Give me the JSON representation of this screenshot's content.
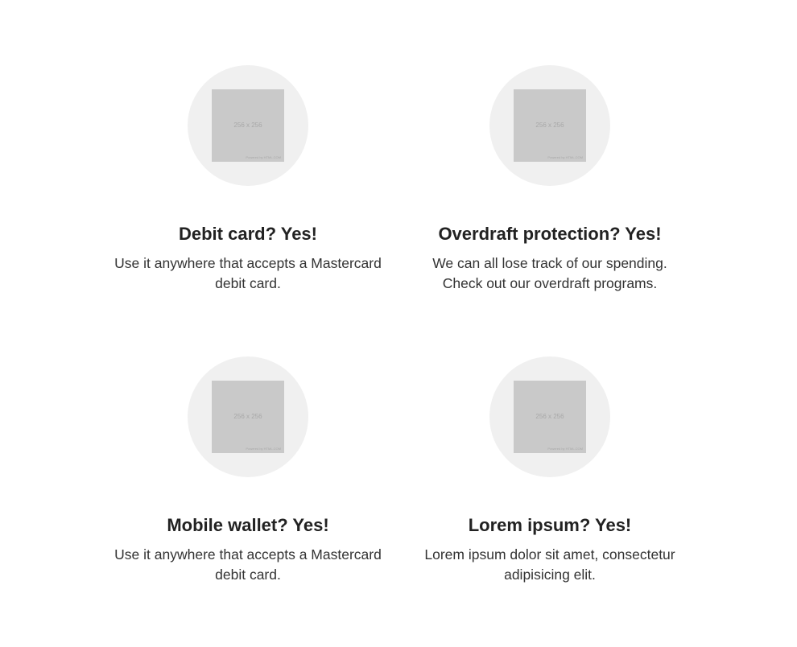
{
  "features": [
    {
      "title": "Debit card? Yes!",
      "description": "Use it anywhere that accepts a Mastercard debit card.",
      "image": {
        "size_label": "256 x 256",
        "credit": "Powered by HTML.COM",
        "icon": "image-placeholder-icon"
      }
    },
    {
      "title": "Overdraft protection? Yes!",
      "description": "We can all lose track of our spending. Check out our overdraft programs.",
      "image": {
        "size_label": "256 x 256",
        "credit": "Powered by HTML.COM",
        "icon": "image-placeholder-icon"
      }
    },
    {
      "title": "Mobile wallet? Yes!",
      "description": "Use it anywhere that accepts a Mastercard debit card.",
      "image": {
        "size_label": "256 x 256",
        "credit": "Powered by HTML.COM",
        "icon": "image-placeholder-icon"
      }
    },
    {
      "title": "Lorem ipsum? Yes!",
      "description": "Lorem ipsum dolor sit amet, consectetur adipisicing elit.",
      "image": {
        "size_label": "256 x 256",
        "credit": "Powered by HTML.COM",
        "icon": "image-placeholder-icon"
      }
    }
  ],
  "colors": {
    "circle_background": "#f0f0f0",
    "placeholder_fill": "#c9c9c9",
    "heading_text": "#222222",
    "body_text": "#333333"
  }
}
